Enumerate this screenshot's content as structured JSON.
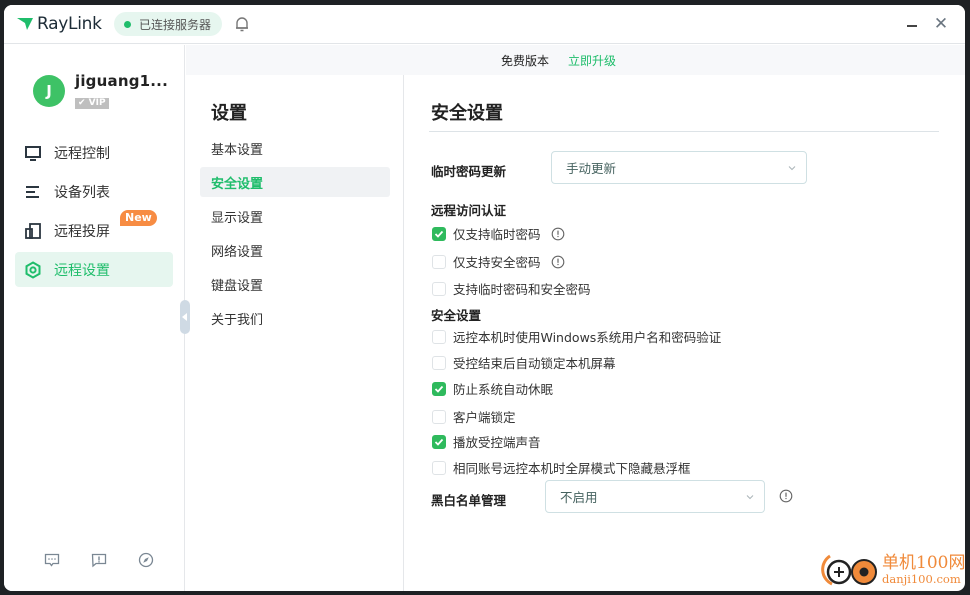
{
  "app": {
    "name": "RayLink",
    "connection_status": "已连接服务器",
    "accent_color": "#1fbd6b"
  },
  "window_controls": {
    "minimize": "minimize",
    "close": "close"
  },
  "user": {
    "avatar_initial": "J",
    "name": "jiguang1...",
    "tier": "✔ VIP"
  },
  "sidebar": {
    "items": [
      {
        "label": "远程控制",
        "icon": "monitor-icon",
        "active": false
      },
      {
        "label": "设备列表",
        "icon": "list-icon",
        "active": false
      },
      {
        "label": "远程投屏",
        "icon": "screen-cast-icon",
        "active": false,
        "badge": "New"
      },
      {
        "label": "远程设置",
        "icon": "settings-hex-icon",
        "active": true
      }
    ],
    "bottom_icons": [
      "chat-icon",
      "feedback-icon",
      "compass-icon"
    ]
  },
  "banner": {
    "edition": "免费版本",
    "upgrade_link": "立即升级"
  },
  "settings_menu": {
    "title": "设置",
    "items": [
      {
        "label": "基本设置",
        "active": false
      },
      {
        "label": "安全设置",
        "active": true
      },
      {
        "label": "显示设置",
        "active": false
      },
      {
        "label": "网络设置",
        "active": false
      },
      {
        "label": "键盘设置",
        "active": false
      },
      {
        "label": "关于我们",
        "active": false
      }
    ]
  },
  "content": {
    "title": "安全设置",
    "temp_password_update": {
      "label": "临时密码更新",
      "value": "手动更新"
    },
    "remote_auth": {
      "title": "远程访问认证",
      "options": [
        {
          "label": "仅支持临时密码",
          "checked": true,
          "info": true
        },
        {
          "label": "仅支持安全密码",
          "checked": false,
          "info": true
        },
        {
          "label": "支持临时密码和安全密码",
          "checked": false,
          "info": false
        }
      ]
    },
    "security": {
      "title": "安全设置",
      "options": [
        {
          "label": "远控本机时使用Windows系统用户名和密码验证",
          "checked": false
        },
        {
          "label": "受控结束后自动锁定本机屏幕",
          "checked": false
        },
        {
          "label": "防止系统自动休眠",
          "checked": true
        },
        {
          "label": "客户端锁定",
          "checked": false
        },
        {
          "label": "播放受控端声音",
          "checked": true
        },
        {
          "label": "相同账号远控本机时全屏模式下隐藏悬浮框",
          "checked": false
        }
      ]
    },
    "blacklist": {
      "label": "黑白名单管理",
      "value": "不启用"
    }
  },
  "watermark": {
    "cn": "单机100网",
    "en": "danji100.com"
  }
}
